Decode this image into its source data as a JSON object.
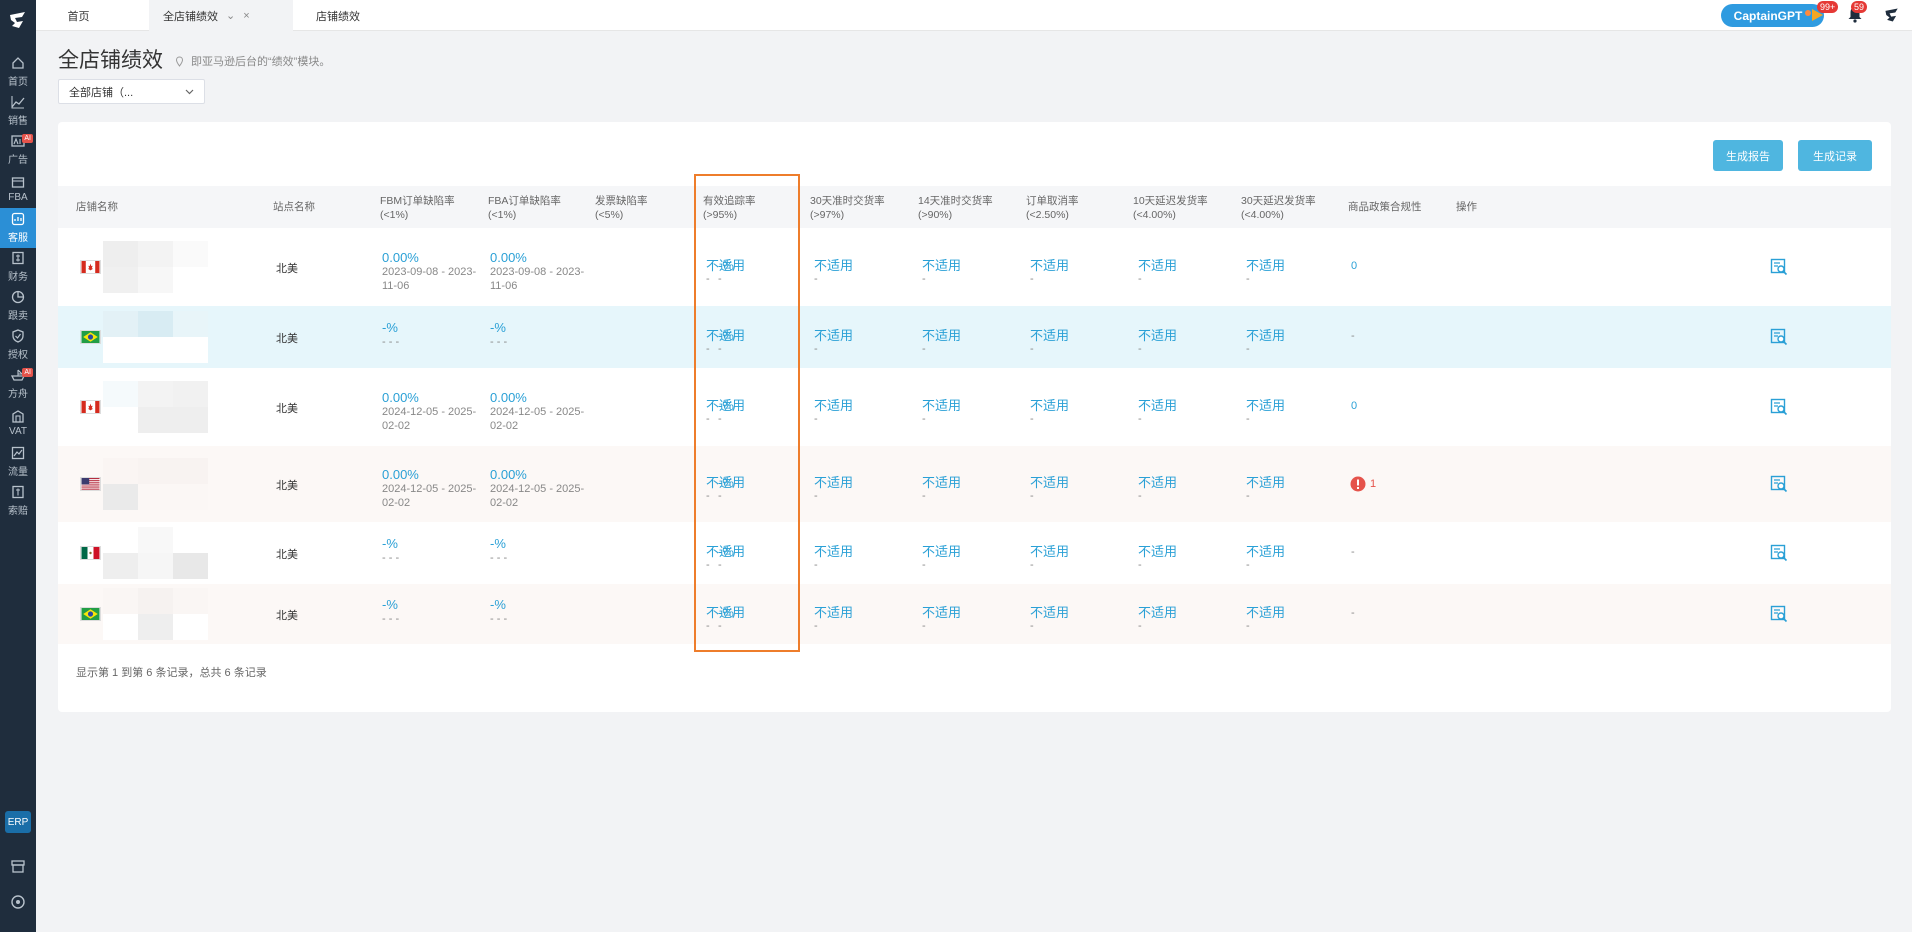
{
  "topbar": {
    "tabs": [
      {
        "label": "首页"
      },
      {
        "label": "全店铺绩效"
      },
      {
        "label": "店铺绩效"
      }
    ],
    "captain_gpt": "CaptainGPT",
    "flag_badge": "99+",
    "bell_badge": "59"
  },
  "sidebar": {
    "items": [
      {
        "label": "首页",
        "icon": "home-icon"
      },
      {
        "label": "销售",
        "icon": "chart-icon"
      },
      {
        "label": "广告",
        "icon": "ads-icon",
        "badge": "AI"
      },
      {
        "label": "FBA",
        "icon": "box-icon"
      },
      {
        "label": "客服",
        "icon": "service-icon"
      },
      {
        "label": "财务",
        "icon": "finance-icon"
      },
      {
        "label": "跟卖",
        "icon": "pie-icon"
      },
      {
        "label": "授权",
        "icon": "shield-icon"
      },
      {
        "label": "方舟",
        "icon": "ark-icon",
        "badge": "AI"
      },
      {
        "label": "VAT",
        "icon": "vat-icon"
      },
      {
        "label": "流量",
        "icon": "traffic-icon"
      },
      {
        "label": "索赔",
        "icon": "claim-icon"
      }
    ],
    "erp": "ERP"
  },
  "page": {
    "title": "全店铺绩效",
    "hint": "即亚马逊后台的“绩效”模块。",
    "store_select": "全部店铺（...",
    "btn_report": "生成报告",
    "btn_records": "生成记录",
    "footer": "显示第 1 到第 6 条记录，总共 6 条记录"
  },
  "columns": [
    {
      "label": "店铺名称",
      "sub": ""
    },
    {
      "label": "站点名称",
      "sub": ""
    },
    {
      "label": "FBM订单缺陷率",
      "sub": "(<1%)"
    },
    {
      "label": "FBA订单缺陷率",
      "sub": "(<1%)"
    },
    {
      "label": "发票缺陷率",
      "sub": "(<5%)"
    },
    {
      "label": "有效追踪率",
      "sub": "(>95%)"
    },
    {
      "label": "30天准时交货率",
      "sub": "(>97%)"
    },
    {
      "label": "14天准时交货率",
      "sub": "(>90%)"
    },
    {
      "label": "订单取消率",
      "sub": "(<2.50%)"
    },
    {
      "label": "10天延迟发货率",
      "sub": "(<4.00%)"
    },
    {
      "label": "30天延迟发货率",
      "sub": "(<4.00%)"
    },
    {
      "label": "商品政策合规性",
      "sub": ""
    },
    {
      "label": "操作",
      "sub": ""
    }
  ],
  "rows": [
    {
      "flag": "canada",
      "site": "北美",
      "fbm": "0.00%",
      "fbm_sub": "2023-09-08 - 2023-11-06",
      "fba": "0.00%",
      "fba_sub": "2023-09-08 - 2023-11-06",
      "invoice": "-%",
      "invoice_sub": "-",
      "na": "不适用",
      "na_sub": "-",
      "policy": "0",
      "policy_alert": false
    },
    {
      "flag": "brazil",
      "site": "北美",
      "fbm": "-%",
      "fbm_sub": "- - -",
      "fba": "-%",
      "fba_sub": "- - -",
      "invoice": "-%",
      "invoice_sub": "-",
      "na": "不适用",
      "na_sub": "-",
      "policy": "-",
      "policy_alert": false
    },
    {
      "flag": "canada",
      "site": "北美",
      "fbm": "0.00%",
      "fbm_sub": "2024-12-05 - 2025-02-02",
      "fba": "0.00%",
      "fba_sub": "2024-12-05 - 2025-02-02",
      "invoice": "-%",
      "invoice_sub": "-",
      "na": "不适用",
      "na_sub": "-",
      "policy": "0",
      "policy_alert": false
    },
    {
      "flag": "usa",
      "site": "北美",
      "fbm": "0.00%",
      "fbm_sub": "2024-12-05 - 2025-02-02",
      "fba": "0.00%",
      "fba_sub": "2024-12-05 - 2025-02-02",
      "invoice": "-%",
      "invoice_sub": "-",
      "na": "不适用",
      "na_sub": "-",
      "policy": "1",
      "policy_alert": true
    },
    {
      "flag": "mexico",
      "site": "北美",
      "fbm": "-%",
      "fbm_sub": "- - -",
      "fba": "-%",
      "fba_sub": "- - -",
      "invoice": "-%",
      "invoice_sub": "-",
      "na": "不适用",
      "na_sub": "-",
      "policy": "-",
      "policy_alert": false
    },
    {
      "flag": "brazil",
      "site": "北美",
      "fbm": "-%",
      "fbm_sub": "- - -",
      "fba": "-%",
      "fba_sub": "- - -",
      "invoice": "-%",
      "invoice_sub": "-",
      "na": "不适用",
      "na_sub": "-",
      "policy": "-",
      "policy_alert": false
    }
  ],
  "colors": {
    "accent": "#2aa0d6",
    "highlight_row": "#e6f6fb",
    "alt_row": "#fcf8f6",
    "box": "#ee7d2b"
  }
}
